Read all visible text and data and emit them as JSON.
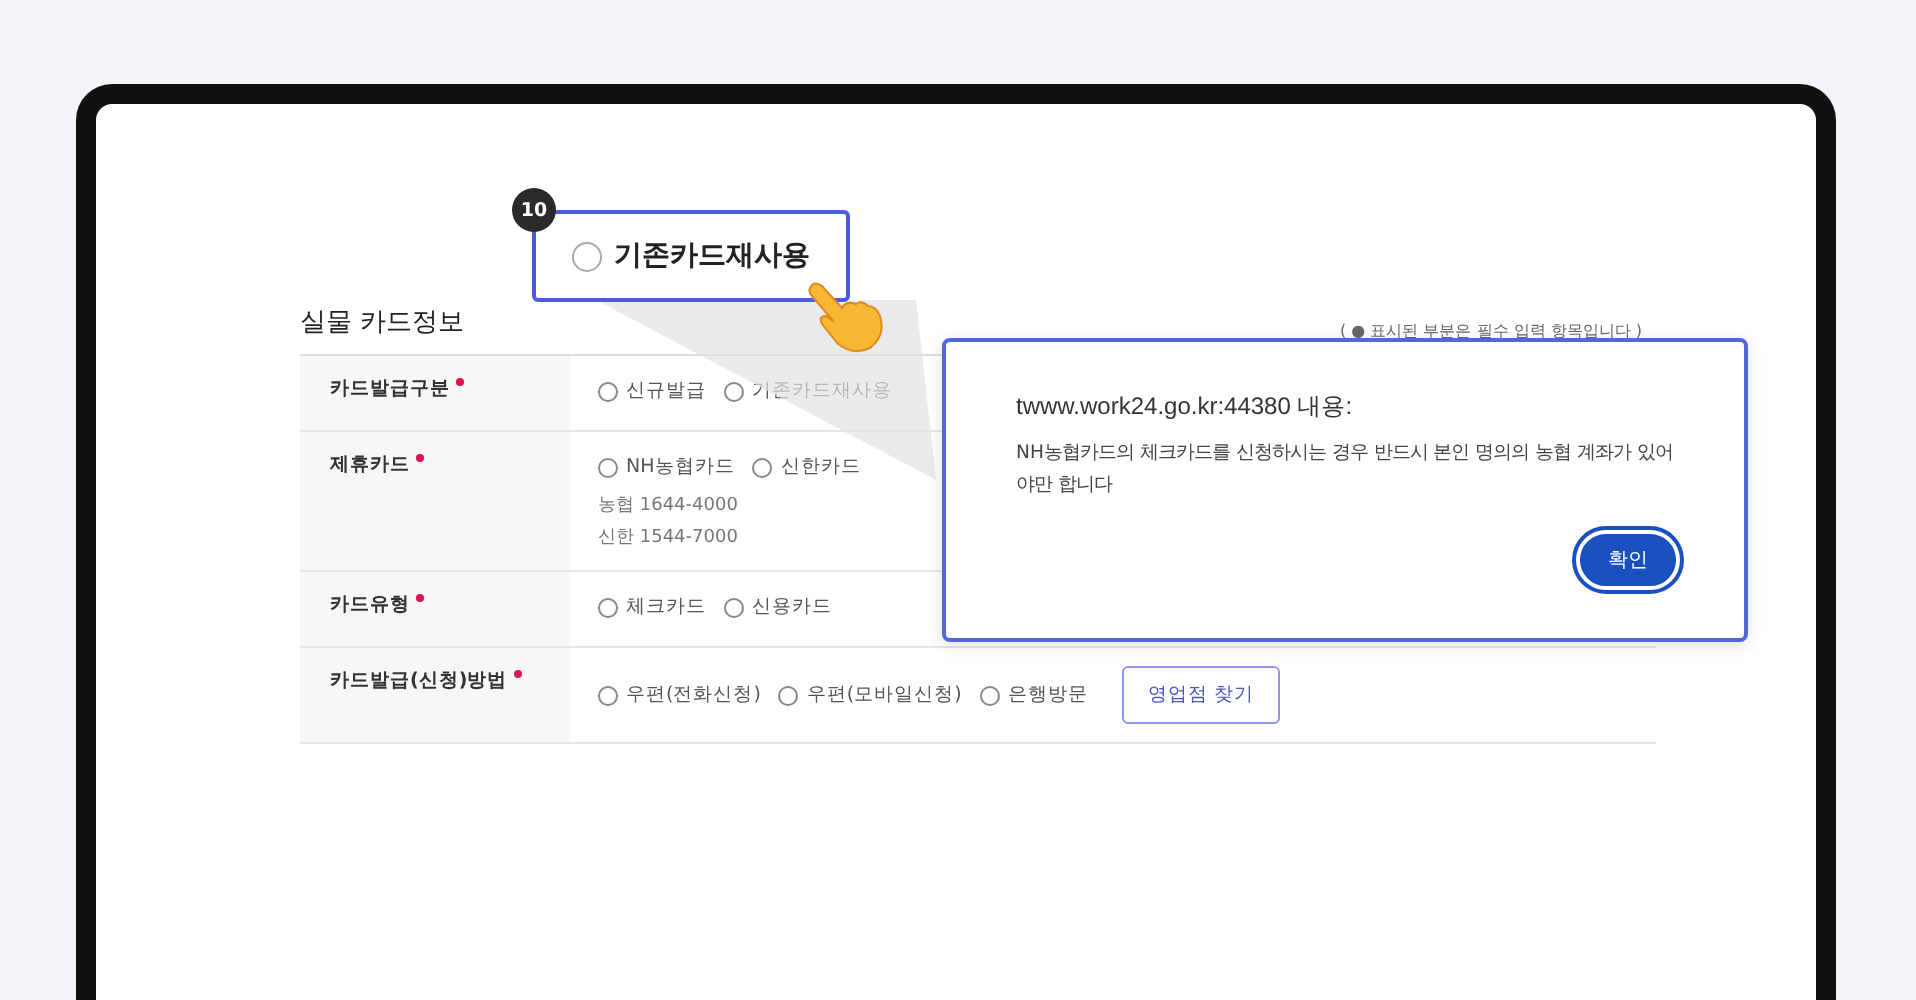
{
  "callout": {
    "badge": "10",
    "label": "기존카드재사용",
    "selected": false
  },
  "section": {
    "title": "실물 카드정보",
    "legend": "( ● 표시된 부분은 필수 입력 항목입니다 )"
  },
  "rows": [
    {
      "label": "카드발급구분",
      "required": true,
      "options": [
        {
          "label": "신규발급",
          "selected": false
        },
        {
          "label": "기존카드재사용",
          "selected": false
        }
      ]
    },
    {
      "label": "제휴카드",
      "required": true,
      "options": [
        {
          "label": "NH농협카드",
          "selected": false
        },
        {
          "label": "신한카드",
          "selected": false
        }
      ],
      "notes": [
        "농협 1644-4000",
        "신한 1544-7000"
      ]
    },
    {
      "label": "카드유형",
      "required": true,
      "options": [
        {
          "label": "체크카드",
          "selected": false
        },
        {
          "label": "신용카드",
          "selected": false
        }
      ]
    },
    {
      "label": "카드발급(신청)방법",
      "required": true,
      "options": [
        {
          "label": "우편(전화신청)",
          "selected": false
        },
        {
          "label": "우편(모바일신청)",
          "selected": false
        },
        {
          "label": "은행방문",
          "selected": false
        }
      ],
      "button": "영업점 찾기"
    }
  ],
  "dialog": {
    "title": "twww.work24.go.kr:44380 내용:",
    "message": "NH농협카드의 체크카드를 신청하시는 경우 반드시 본인 명의의 농협 계좌가 있어야만 합니다",
    "button": "확인"
  }
}
